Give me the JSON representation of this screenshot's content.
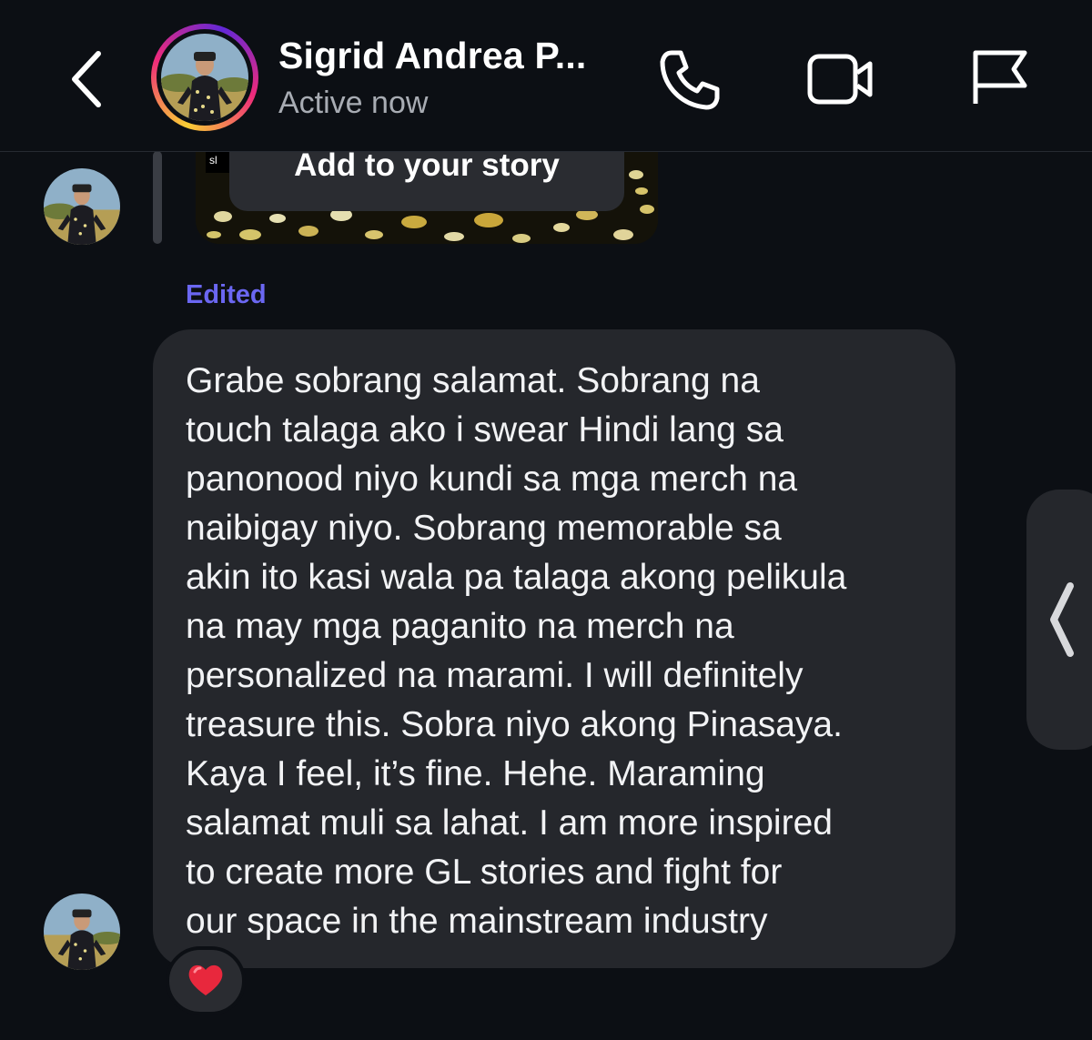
{
  "header": {
    "contact_name": "Sigrid Andrea P...",
    "status": "Active now"
  },
  "story": {
    "pill_label": "Add to your story",
    "tag_text": "sl"
  },
  "message": {
    "edited_label": "Edited",
    "text": "Grabe sobrang salamat. Sobrang na\ntouch talaga ako i swear Hindi lang sa\npanonood niyo kundi sa mga merch na\nnaibigay niyo. Sobrang memorable sa\nakin ito kasi wala pa talaga akong pelikula\nna may mga paganito na merch na\npersonalized na marami. I will definitely\ntreasure this. Sobra niyo akong Pinasaya.\nKaya I feel, it’s fine. Hehe. Maraming\nsalamat muli sa lahat. I am more inspired\nto create more GL stories and fight for\nour space in the mainstream industry",
    "reaction": "❤️"
  },
  "icons": {
    "back": "chevron-left-icon",
    "call": "phone-icon",
    "video": "video-camera-icon",
    "report": "flag-icon",
    "side_panel": "chevron-left-icon"
  },
  "colors": {
    "background": "#0c0f14",
    "bubble": "#25272c",
    "edited": "#6b67f2",
    "status": "#a8acb3"
  }
}
